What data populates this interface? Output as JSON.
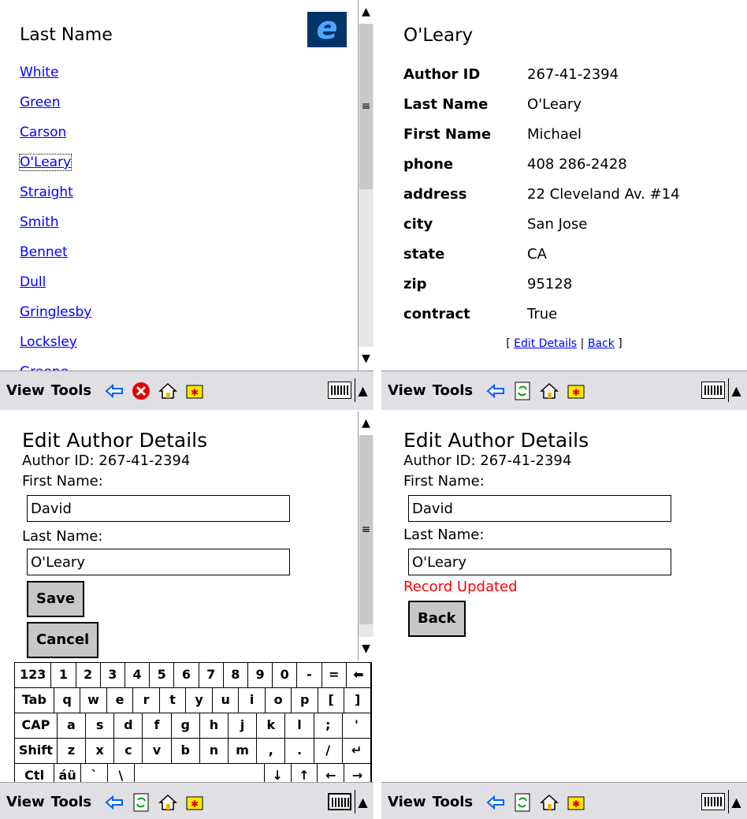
{
  "list_screen": {
    "title": "Last Name",
    "names": [
      "White",
      "Green",
      "Carson",
      "O'Leary",
      "Straight",
      "Smith",
      "Bennet",
      "Dull",
      "Gringlesby",
      "Locksley",
      "Greene"
    ]
  },
  "detail_screen": {
    "title": "O'Leary",
    "fields": [
      {
        "label": "Author ID",
        "value": "267-41-2394"
      },
      {
        "label": "Last Name",
        "value": "O'Leary"
      },
      {
        "label": "First Name",
        "value": "Michael"
      },
      {
        "label": "phone",
        "value": "408 286-2428"
      },
      {
        "label": "address",
        "value": "22 Cleveland Av. #14"
      },
      {
        "label": "city",
        "value": "San Jose"
      },
      {
        "label": "state",
        "value": "CA"
      },
      {
        "label": "zip",
        "value": "95128"
      },
      {
        "label": "contract",
        "value": "True"
      }
    ],
    "links": {
      "open": "[ ",
      "edit": "Edit Details",
      "sep": " | ",
      "back": "Back",
      "close": " ]"
    }
  },
  "edit_screen": {
    "title": "Edit Author Details",
    "author_id": "Author ID: 267-41-2394",
    "first_name_label": "First Name:",
    "first_name_value": "David",
    "last_name_label": "Last Name:",
    "last_name_value": "O'Leary",
    "save_label": "Save",
    "cancel_label": "Cancel",
    "keyboard": [
      [
        "123",
        "1",
        "2",
        "3",
        "4",
        "5",
        "6",
        "7",
        "8",
        "9",
        "0",
        "-",
        "=",
        "⬅"
      ],
      [
        "Tab",
        "q",
        "w",
        "e",
        "r",
        "t",
        "y",
        "u",
        "i",
        "o",
        "p",
        "[",
        "]"
      ],
      [
        "CAP",
        "a",
        "s",
        "d",
        "f",
        "g",
        "h",
        "j",
        "k",
        "l",
        ";",
        "'"
      ],
      [
        "Shift",
        "z",
        "x",
        "c",
        "v",
        "b",
        "n",
        "m",
        ",",
        ".",
        "/",
        "↵"
      ],
      [
        "Ctl",
        "áü",
        "`",
        "\\",
        " ",
        "↓",
        "↑",
        "←",
        "→"
      ]
    ]
  },
  "updated_screen": {
    "title": "Edit Author Details",
    "author_id": "Author ID: 267-41-2394",
    "first_name_label": "First Name:",
    "first_name_value": "David",
    "last_name_label": "Last Name:",
    "last_name_value": "O'Leary",
    "status": "Record Updated",
    "back_label": "Back"
  },
  "taskbar": {
    "view": "View",
    "tools": "Tools"
  },
  "colors": {
    "link": "#0000ff",
    "status": "#ff0000",
    "taskbar": "#e0dfe3",
    "button": "#c7c7c7"
  }
}
